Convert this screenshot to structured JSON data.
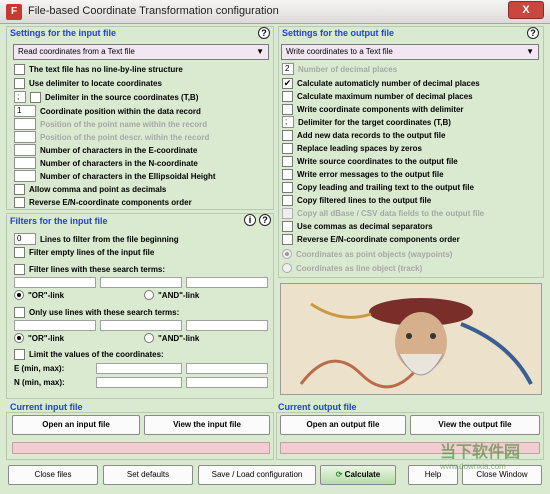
{
  "window": {
    "title": "File-based Coordinate Transformation configuration",
    "close": "X",
    "icon_letter": "F"
  },
  "input_settings": {
    "title": "Settings for the input file",
    "read_mode": "Read coordinates from a Text file",
    "checkboxes": [
      "The text file has no line-by-line structure",
      "Use delimiter to locate coordinates",
      "Delimiter in the source coordinates (T,B)"
    ],
    "delimiter_value": ";",
    "fields": [
      {
        "value": "1",
        "label": "Coordinate position within the data record",
        "disabled": false
      },
      {
        "value": "",
        "label": "Position of the point name within the record",
        "disabled": true
      },
      {
        "value": "",
        "label": "Position of the point descr. within the record",
        "disabled": true
      },
      {
        "value": "",
        "label": "Number of characters in the E-coordinate",
        "disabled": false
      },
      {
        "value": "",
        "label": "Number of characters in the N-coordinate",
        "disabled": false
      },
      {
        "value": "",
        "label": "Number of characters in the Ellipsoidal Height",
        "disabled": false
      }
    ],
    "extra_checkboxes": [
      "Allow comma and point as decimals",
      "Reverse E/N-coordinate components order"
    ]
  },
  "filters": {
    "title": "Filters for the input file",
    "lines_to_filter_value": "0",
    "lines_to_filter_label": "Lines to filter from the file beginning",
    "filter_empty": "Filter empty lines of the input file",
    "filter_search": "Filter lines with these search terms:",
    "or_link": "\"OR\"-link",
    "and_link": "\"AND\"-link",
    "only_use": "Only use lines with these search terms:",
    "limit_values": "Limit the values of the coordinates:",
    "e_range": "E (min, max):",
    "n_range": "N (min, max):"
  },
  "output_settings": {
    "title": "Settings for the output file",
    "write_mode": "Write coordinates to a Text file",
    "decimal_value": "2",
    "decimal_label": "Number of decimal places",
    "checkboxes": [
      {
        "label": "Calculate automaticly number of decimal places",
        "checked": true,
        "disabled": false
      },
      {
        "label": "Calculate maximum number of decimal places",
        "checked": false,
        "disabled": false
      },
      {
        "label": "Write coordinate components with delimiter",
        "checked": false,
        "disabled": false
      }
    ],
    "delimiter_value": ";",
    "delimiter_label": "Delimiter for the target coordinates (T,B)",
    "more_checkboxes": [
      {
        "label": "Add new data records to the output file",
        "disabled": false
      },
      {
        "label": "Replace leading spaces by zeros",
        "disabled": false
      },
      {
        "label": "Write source coordinates to the output file",
        "disabled": false
      },
      {
        "label": "Write error messages to the output file",
        "disabled": false
      },
      {
        "label": "Copy leading and trailing text to the output file",
        "disabled": false
      },
      {
        "label": "Copy filtered lines to the output file",
        "disabled": false
      },
      {
        "label": "Copy all dBase / CSV data fields to the output file",
        "disabled": true
      },
      {
        "label": "Use commas as decimal separators",
        "disabled": false
      },
      {
        "label": "Reverse E/N-coordinate components order",
        "disabled": false
      }
    ],
    "radios": [
      "Coordinates as point objects (waypoints)",
      "Coordinates as line object (track)"
    ]
  },
  "current_input": {
    "title": "Current input file",
    "open": "Open an input file",
    "view": "View the input file"
  },
  "current_output": {
    "title": "Current output file",
    "open": "Open an output file",
    "view": "View the output file"
  },
  "bottom_buttons": {
    "close_files": "Close files",
    "set_defaults": "Set defaults",
    "save_load": "Save / Load configuration",
    "calculate": "Calculate",
    "help": "Help",
    "close_window": "Close Window"
  },
  "watermark": {
    "cn": "当下软件园",
    "url": "www.downxia.com"
  },
  "colors": {
    "section_title": "#1f43d8",
    "background": "#d9ead0",
    "select_bg": "#f2e6f3",
    "pink_field": "#f2ccd0"
  }
}
